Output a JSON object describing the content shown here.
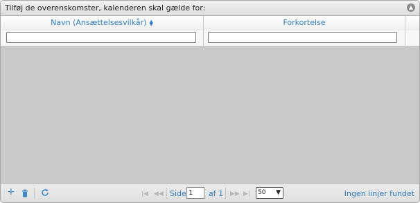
{
  "panel": {
    "title": "Tilføj de overenskomster, kalenderen skal gælde for:"
  },
  "grid": {
    "columns": [
      {
        "label": "Navn (Ansættelsesvilkår)",
        "sorted": true
      },
      {
        "label": "Forkortelse",
        "sorted": false
      }
    ],
    "filters": [
      "",
      ""
    ],
    "rows": []
  },
  "pager": {
    "page_label": "Side",
    "page_value": "1",
    "of_label": "af 1",
    "page_size": "50",
    "records_text": "Ingen linjer fundet"
  },
  "icons": {
    "add": "plus-icon",
    "delete": "trash-icon",
    "refresh": "refresh-icon",
    "collapse": "collapse-up-icon"
  },
  "colors": {
    "accent": "#2e7bbf",
    "grid_background": "#c9c9c9"
  }
}
